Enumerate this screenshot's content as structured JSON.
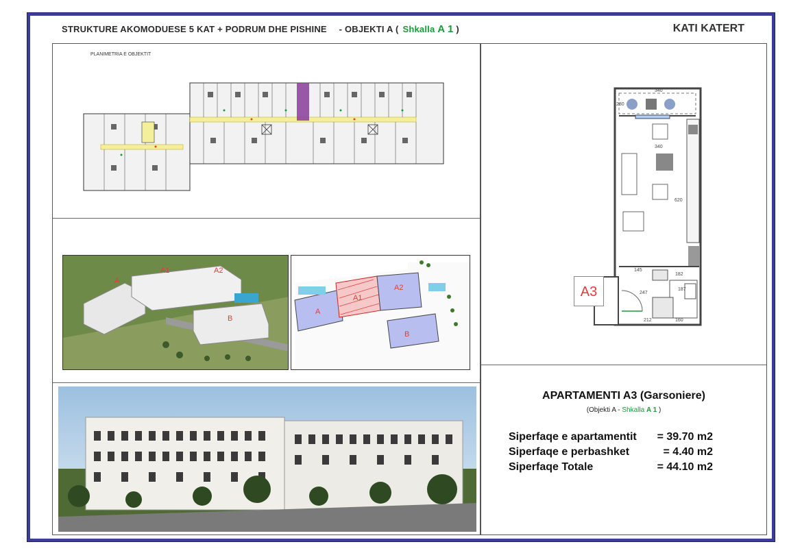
{
  "header": {
    "title_main": "STRUKTURE AKOMODUESE 5 KAT + PODRUM DHE PISHINE",
    "title_sep": "- OBJEKTI A (",
    "title_stair_prefix": "Shkalla ",
    "title_stair_code": "A 1",
    "title_close": " )",
    "floor_label": "KATI KATERT"
  },
  "site_plan": {
    "caption": "PLANIMETRIA E OBJEKTIT"
  },
  "aerial_render": {
    "labels": [
      "A",
      "A1",
      "A2",
      "B"
    ]
  },
  "block_plan": {
    "labels": [
      "A",
      "A1",
      "A2",
      "B"
    ]
  },
  "apartment_plan": {
    "dimensions": [
      "340",
      "280",
      "340",
      "620",
      "145",
      "247",
      "212",
      "160",
      "187",
      "182"
    ],
    "unit_tag": "A3"
  },
  "apartment_info": {
    "title": "APARTAMENTI A3 (Garsoniere)",
    "sub_prefix": "(Objekti A - ",
    "sub_stair": "Shkalla ",
    "sub_code": "A 1",
    "sub_close": " )",
    "areas": [
      {
        "label": "Siperfaqe e apartamentit",
        "value": "= 39.70 m2"
      },
      {
        "label": "Siperfaqe e perbashket",
        "value": "=  4.40 m2"
      },
      {
        "label": "Siperfaqe Totale",
        "value": "= 44.10 m2"
      }
    ]
  },
  "colors": {
    "frame": "#3c3d94",
    "accent_green": "#1a9a3a",
    "label_red": "#e23c3c",
    "corridor_yellow": "#f4ef9a",
    "stair_purple": "#8a3c9a"
  }
}
